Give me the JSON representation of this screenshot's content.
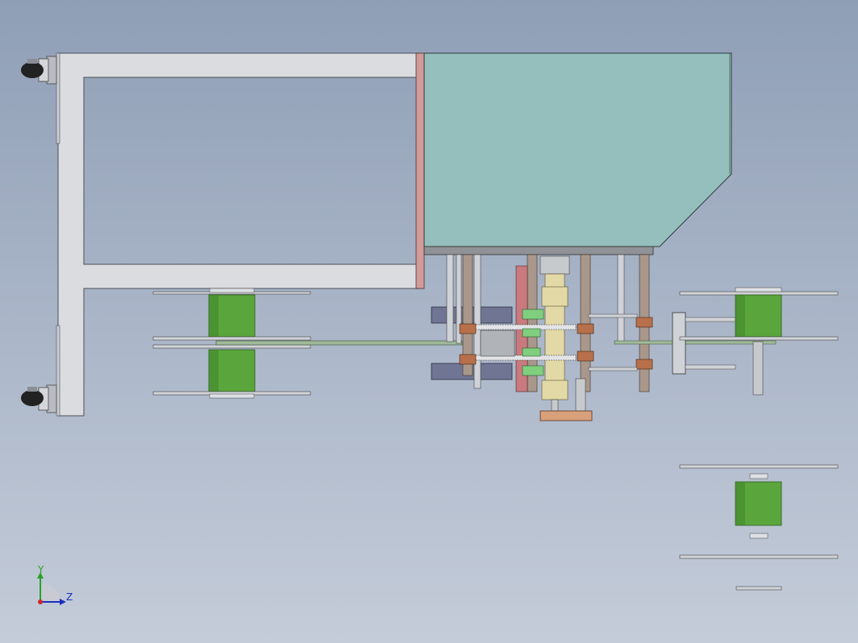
{
  "viewport": {
    "background_top": "#8f9fb6",
    "background_bottom": "#c4ccd9"
  },
  "colors": {
    "frame": "#dadcdf",
    "frame_edge": "#4a4f57",
    "hopper": "#94bfbc",
    "hopper_edge": "#2f3a3a",
    "spool": "#5aa63c",
    "spool_dark": "#3d7f2a",
    "disc": "#d0d3d8",
    "copper": "#b8704a",
    "pink_plate": "#d29a9a",
    "slate": "#6f7592",
    "tan": "#e3d9a6",
    "green_block": "#7fcf7f"
  },
  "triad": {
    "y_label": "Y",
    "z_label": "Z",
    "y_color": "#2aa02a",
    "z_color": "#1b2fbf",
    "x_color": "#d12626"
  },
  "icons": {
    "caster": "caster-wheel-icon",
    "triad": "coordinate-triad-icon"
  }
}
